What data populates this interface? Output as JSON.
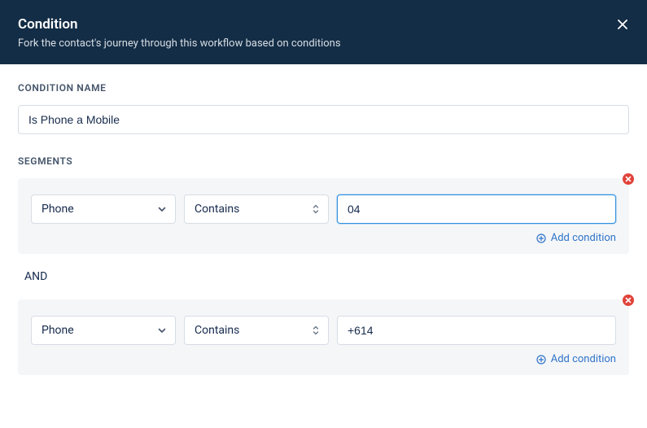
{
  "header": {
    "title": "Condition",
    "subtitle": "Fork the contact's journey through this workflow based on conditions"
  },
  "condition_name": {
    "label": "CONDITION NAME",
    "value": "Is Phone a Mobile"
  },
  "segments_label": "SEGMENTS",
  "segments": [
    {
      "field": "Phone",
      "operator": "Contains",
      "value": "04",
      "focused": true,
      "add_label": "Add condition"
    },
    {
      "field": "Phone",
      "operator": "Contains",
      "value": "+614",
      "focused": false,
      "add_label": "Add condition"
    }
  ],
  "joiner": "AND"
}
